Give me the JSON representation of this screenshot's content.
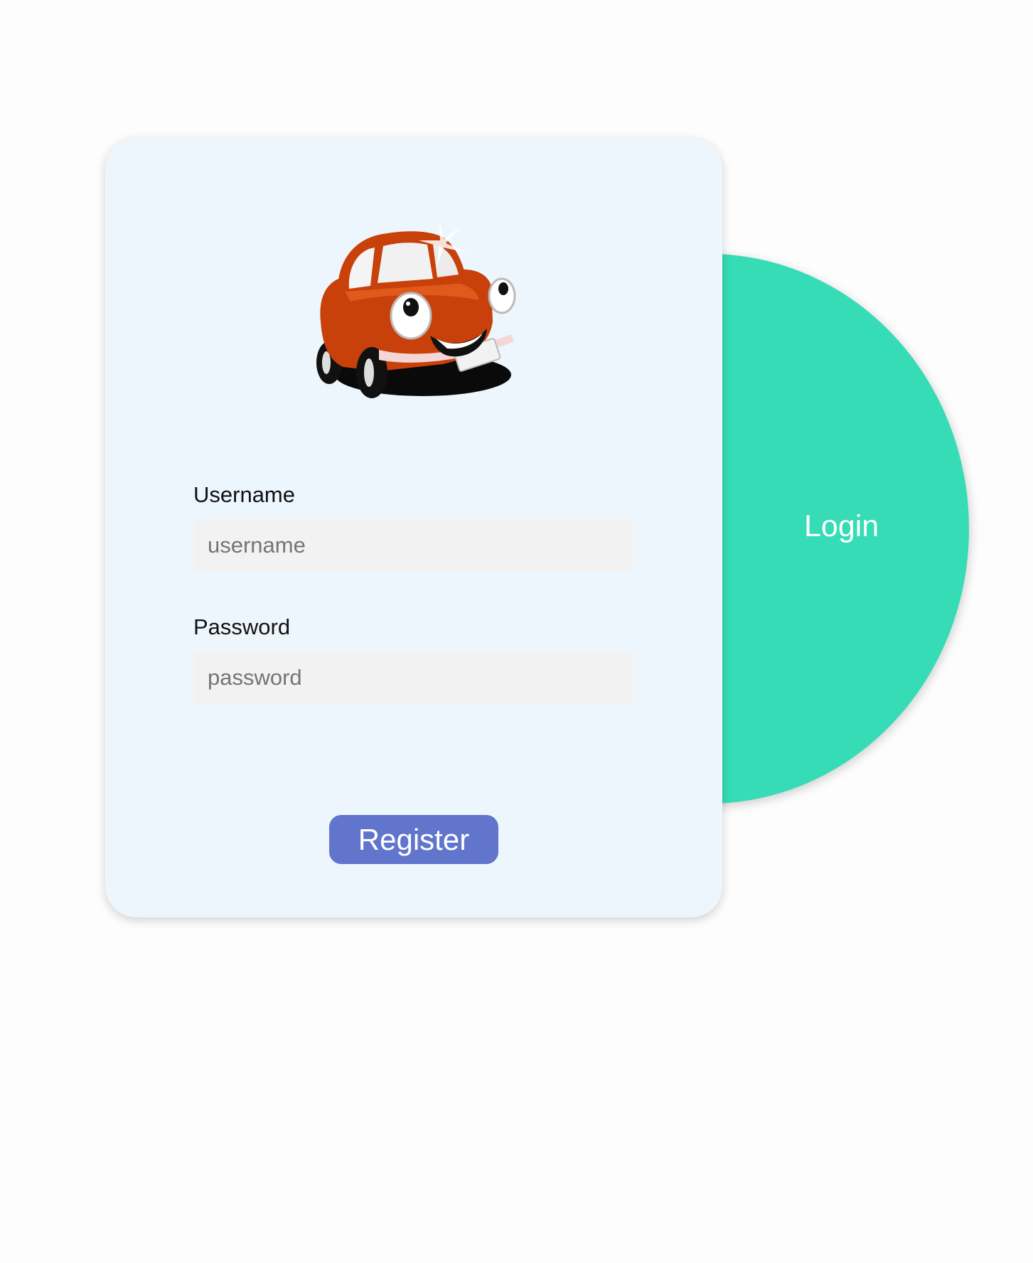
{
  "form": {
    "logo_alt": "car-mascot-logo",
    "username_label": "Username",
    "username_placeholder": "username",
    "username_value": "",
    "password_label": "Password",
    "password_placeholder": "password",
    "password_value": "",
    "register_label": "Register"
  },
  "switch_panel": {
    "login_label": "Login"
  },
  "colors": {
    "page_background": "#fdfdfd",
    "card_background": "#eef6fd",
    "accent_circle": "#35dcb6",
    "register_button": "#6175cc",
    "input_background": "#f2f2f2",
    "car_body": "#c8400a"
  }
}
